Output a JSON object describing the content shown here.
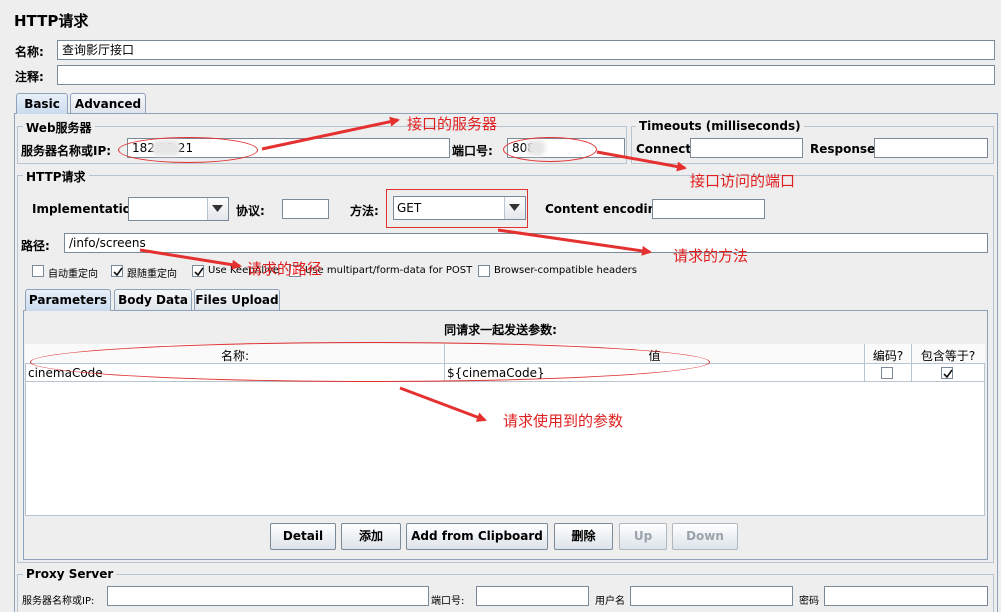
{
  "page": {
    "title": "HTTP请求"
  },
  "form": {
    "name_label": "名称:",
    "name_value": "查询影厅接口",
    "comment_label": "注释:",
    "comment_value": ""
  },
  "tabs": {
    "basic": "Basic",
    "advanced": "Advanced"
  },
  "web_server": {
    "legend": "Web服务器",
    "server_label": "服务器名称或IP:",
    "server_value": "182       15.21",
    "port_label": "端口号:",
    "port_value": "808"
  },
  "timeouts": {
    "legend": "Timeouts (milliseconds)",
    "connect_label": "Connect:",
    "response_label": "Response:"
  },
  "http_request": {
    "legend": "HTTP请求",
    "implementation_label": "Implementation:",
    "protocol_label": "协议:",
    "method_label": "方法:",
    "method_value": "GET",
    "encoding_label": "Content encoding:",
    "path_label": "路径:",
    "path_value": "/info/screens"
  },
  "checkboxes": [
    {
      "label": "自动重定向",
      "checked": false
    },
    {
      "label": "跟随重定向",
      "checked": true
    },
    {
      "label": "Use KeepAlive",
      "checked": true
    },
    {
      "label": "Use multipart/form-data for POST",
      "checked": false
    },
    {
      "label": "Browser-compatible headers",
      "checked": false
    }
  ],
  "subtabs": {
    "parameters": "Parameters",
    "body_data": "Body Data",
    "files_upload": "Files Upload"
  },
  "params": {
    "caption": "同请求一起发送参数:",
    "headers": [
      "名称:",
      "值",
      "编码?",
      "包含等于?"
    ],
    "rows": [
      {
        "name": "cinemaCode",
        "value": "${cinemaCode}",
        "encode": false,
        "include_equals": true
      }
    ]
  },
  "buttons": {
    "detail": "Detail",
    "add": "添加",
    "add_clipboard": "Add from Clipboard",
    "delete": "删除",
    "up": "Up",
    "down": "Down"
  },
  "proxy": {
    "legend": "Proxy Server",
    "server_label": "服务器名称或IP:",
    "port_label": "端口号:",
    "user_label": "用户名",
    "password_label": "密码"
  },
  "annotations": {
    "server": "接口的服务器",
    "port": "接口访问的端口",
    "path": "请求的路径",
    "method": "请求的方法",
    "params": "请求使用到的参数"
  },
  "colors": {
    "annotation": "#e02020",
    "tab_border": "#8ea3ba"
  }
}
